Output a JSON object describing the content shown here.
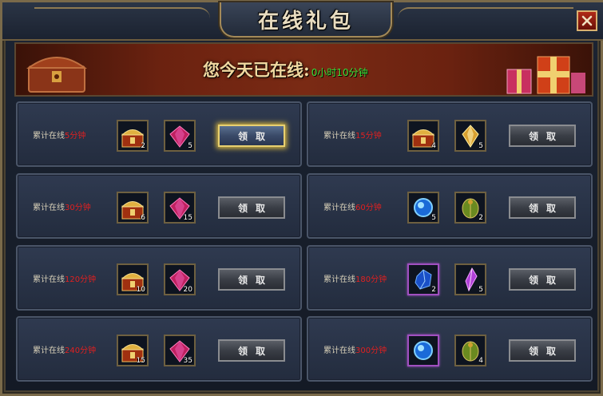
{
  "window": {
    "title": "在线礼包",
    "close_label": "X"
  },
  "banner": {
    "label": "您今天已在线:",
    "time": "0小时10分钟"
  },
  "claim_label": "领取",
  "rewards": [
    {
      "prefix": "累计在线",
      "duration": "5分钟",
      "items": [
        {
          "icon": "gold-chest-icon",
          "qty": "2"
        },
        {
          "icon": "red-gem-icon",
          "qty": "5"
        }
      ],
      "active": true
    },
    {
      "prefix": "累计在线",
      "duration": "15分钟",
      "items": [
        {
          "icon": "gold-chest-icon",
          "qty": "4"
        },
        {
          "icon": "gold-crystal-icon",
          "qty": "5"
        }
      ],
      "active": false
    },
    {
      "prefix": "累计在线",
      "duration": "30分钟",
      "items": [
        {
          "icon": "gold-chest-icon",
          "qty": "6"
        },
        {
          "icon": "red-gem-icon",
          "qty": "15"
        }
      ],
      "active": false
    },
    {
      "prefix": "累计在线",
      "duration": "60分钟",
      "items": [
        {
          "icon": "blue-orb-icon",
          "qty": "5"
        },
        {
          "icon": "green-scarab-icon",
          "qty": "2"
        }
      ],
      "active": false
    },
    {
      "prefix": "累计在线",
      "duration": "120分钟",
      "items": [
        {
          "icon": "gold-chest-icon",
          "qty": "10"
        },
        {
          "icon": "red-gem-icon",
          "qty": "20"
        }
      ],
      "active": false
    },
    {
      "prefix": "累计在线",
      "duration": "180分钟",
      "items": [
        {
          "icon": "blue-gem-icon",
          "qty": "2"
        },
        {
          "icon": "purple-crystal-icon",
          "qty": "5"
        }
      ],
      "active": false
    },
    {
      "prefix": "累计在线",
      "duration": "240分钟",
      "items": [
        {
          "icon": "gold-chest-icon",
          "qty": "15"
        },
        {
          "icon": "red-gem-icon",
          "qty": "35"
        }
      ],
      "active": false
    },
    {
      "prefix": "累计在线",
      "duration": "300分钟",
      "items": [
        {
          "icon": "blue-orb-icon",
          "qty": ""
        },
        {
          "icon": "green-scarab-icon",
          "qty": "4"
        }
      ],
      "active": false
    }
  ],
  "colors": {
    "duration_red": "#e02020",
    "time_green": "#38e038",
    "frame_gold": "#a48a58"
  }
}
